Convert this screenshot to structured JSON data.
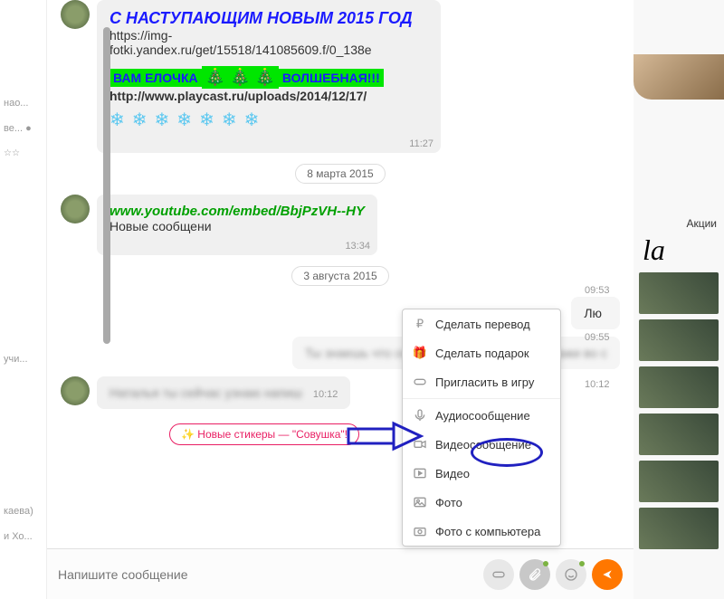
{
  "left_sidebar": {
    "items": [
      "нао...",
      "ве...  ●",
      "☆☆",
      "учи...",
      "каева)",
      "и Хо..."
    ]
  },
  "messages": {
    "m1": {
      "headline": "С НАСТУПАЮЩИМ НОВЫМ 2015 ГОД",
      "url1": "https://img-fotki.yandex.ru/get/15518/141085609.f/0_138e",
      "green1": "ВАМ ЕЛОЧКА",
      "green2": "ВОЛШЕБНАЯ!!!",
      "url2": "http://www.playcast.ru/uploads/2014/12/17/",
      "time": "11:27"
    },
    "sep1": "8 марта 2015",
    "m2": {
      "link": "www.youtube.com/embed/BbjPzVH--HY",
      "text": "Новые сообщени",
      "time": "13:34"
    },
    "sep2": "3 августа 2015",
    "m3": {
      "text": "Лю",
      "time_out": "09:53"
    },
    "m4": {
      "text": "Ты знаешь что сегодня при ирову Никон скажи во с",
      "time_out": "09:55"
    },
    "m4b": {
      "time_out": "10:12"
    },
    "m5": {
      "text": "Наталья ты сейчас узнаю напиш",
      "time": "10:12"
    }
  },
  "stickers_label": "Новые стикеры — \"Совушка\"!",
  "attach_menu": {
    "transfer": "Сделать перевод",
    "gift": "Сделать подарок",
    "invite": "Пригласить в игру",
    "audio": "Аудиосообщение",
    "videomsg": "Видеосообщение",
    "video": "Видео",
    "photo": "Фото",
    "photo_computer": "Фото с компьютера"
  },
  "composer": {
    "placeholder": "Напишите сообщение"
  },
  "right_panel": {
    "ad_label": "Акции",
    "brand": "la"
  },
  "thumb_times": [
    "09:53",
    "09:55",
    "10:12"
  ]
}
